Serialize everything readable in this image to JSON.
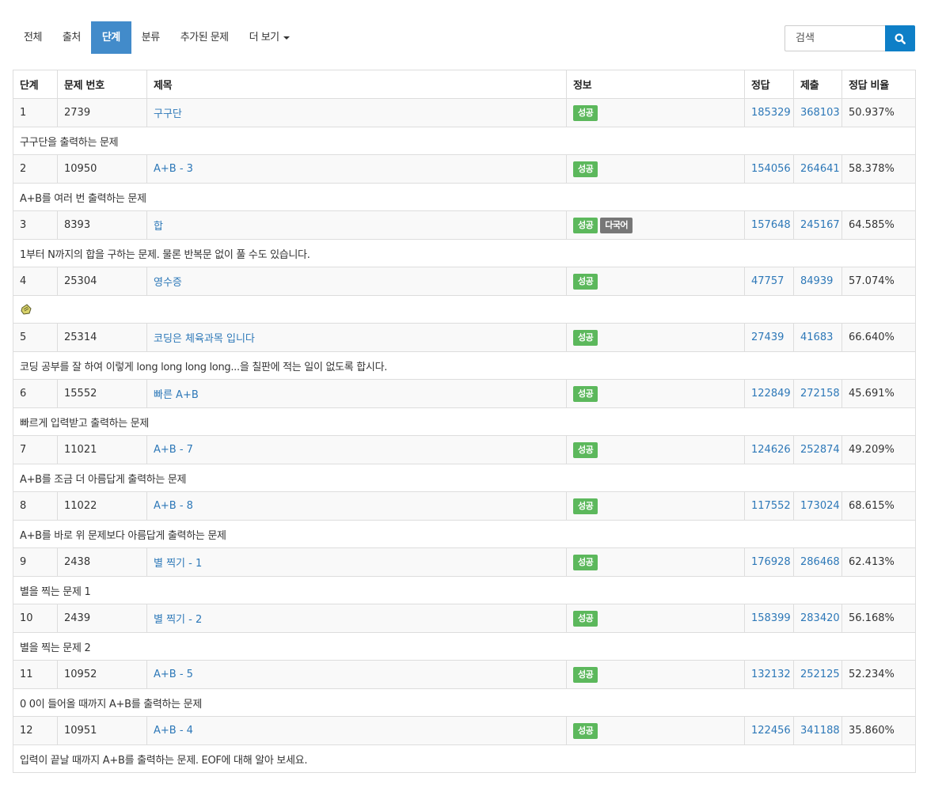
{
  "nav": {
    "tabs": [
      {
        "label": "전체",
        "active": false
      },
      {
        "label": "출처",
        "active": false
      },
      {
        "label": "단계",
        "active": true
      },
      {
        "label": "분류",
        "active": false
      },
      {
        "label": "추가된 문제",
        "active": false
      },
      {
        "label": "더 보기",
        "active": false,
        "dropdown": true
      }
    ]
  },
  "search": {
    "placeholder": "검색",
    "button_icon": "search-icon"
  },
  "colors": {
    "accent": "#428bca",
    "search_button": "#0e7fc7",
    "link": "#2d78b8",
    "success_badge": "#5cb85c",
    "default_badge": "#777777"
  },
  "table": {
    "headers": [
      "단계",
      "문제 번호",
      "제목",
      "정보",
      "정답",
      "제출",
      "정답 비율"
    ],
    "rows": [
      {
        "step": "1",
        "id": "2739",
        "title": "구구단",
        "badges": [
          {
            "text": "성공",
            "type": "success"
          }
        ],
        "correct": "185329",
        "submit": "368103",
        "ratio": "50.937%",
        "desc": "구구단을 출력하는 문제"
      },
      {
        "step": "2",
        "id": "10950",
        "title": "A+B - 3",
        "badges": [
          {
            "text": "성공",
            "type": "success"
          }
        ],
        "correct": "154056",
        "submit": "264641",
        "ratio": "58.378%",
        "desc": "A+B를 여러 번 출력하는 문제"
      },
      {
        "step": "3",
        "id": "8393",
        "title": "합",
        "badges": [
          {
            "text": "성공",
            "type": "success"
          },
          {
            "text": "다국어",
            "type": "default"
          }
        ],
        "correct": "157648",
        "submit": "245167",
        "ratio": "64.585%",
        "desc": "1부터 N까지의 합을 구하는 문제. 물론 반복문 없이 풀 수도 있습니다."
      },
      {
        "step": "4",
        "id": "25304",
        "title": "영수증",
        "badges": [
          {
            "text": "성공",
            "type": "success"
          }
        ],
        "correct": "47757",
        "submit": "84939",
        "ratio": "57.074%",
        "desc": "",
        "desc_icon": "receipt-emoji-icon"
      },
      {
        "step": "5",
        "id": "25314",
        "title": "코딩은 체육과목 입니다",
        "badges": [
          {
            "text": "성공",
            "type": "success"
          }
        ],
        "correct": "27439",
        "submit": "41683",
        "ratio": "66.640%",
        "desc": "코딩 공부를 잘 하여 이렇게 long long long long...을 칠판에 적는 일이 없도록 합시다."
      },
      {
        "step": "6",
        "id": "15552",
        "title": "빠른 A+B",
        "badges": [
          {
            "text": "성공",
            "type": "success"
          }
        ],
        "correct": "122849",
        "submit": "272158",
        "ratio": "45.691%",
        "desc": "빠르게 입력받고 출력하는 문제"
      },
      {
        "step": "7",
        "id": "11021",
        "title": "A+B - 7",
        "badges": [
          {
            "text": "성공",
            "type": "success"
          }
        ],
        "correct": "124626",
        "submit": "252874",
        "ratio": "49.209%",
        "desc": "A+B를 조금 더 아름답게 출력하는 문제"
      },
      {
        "step": "8",
        "id": "11022",
        "title": "A+B - 8",
        "badges": [
          {
            "text": "성공",
            "type": "success"
          }
        ],
        "correct": "117552",
        "submit": "173024",
        "ratio": "68.615%",
        "desc": "A+B를 바로 위 문제보다 아름답게 출력하는 문제"
      },
      {
        "step": "9",
        "id": "2438",
        "title": "별 찍기 - 1",
        "badges": [
          {
            "text": "성공",
            "type": "success"
          }
        ],
        "correct": "176928",
        "submit": "286468",
        "ratio": "62.413%",
        "desc": "별을 찍는 문제 1"
      },
      {
        "step": "10",
        "id": "2439",
        "title": "별 찍기 - 2",
        "badges": [
          {
            "text": "성공",
            "type": "success"
          }
        ],
        "correct": "158399",
        "submit": "283420",
        "ratio": "56.168%",
        "desc": "별을 찍는 문제 2"
      },
      {
        "step": "11",
        "id": "10952",
        "title": "A+B - 5",
        "badges": [
          {
            "text": "성공",
            "type": "success"
          }
        ],
        "correct": "132132",
        "submit": "252125",
        "ratio": "52.234%",
        "desc": "0 0이 들어올 때까지 A+B를 출력하는 문제"
      },
      {
        "step": "12",
        "id": "10951",
        "title": "A+B - 4",
        "badges": [
          {
            "text": "성공",
            "type": "success"
          }
        ],
        "correct": "122456",
        "submit": "341188",
        "ratio": "35.860%",
        "desc": "입력이 끝날 때까지 A+B를 출력하는 문제. EOF에 대해 알아 보세요."
      }
    ]
  }
}
